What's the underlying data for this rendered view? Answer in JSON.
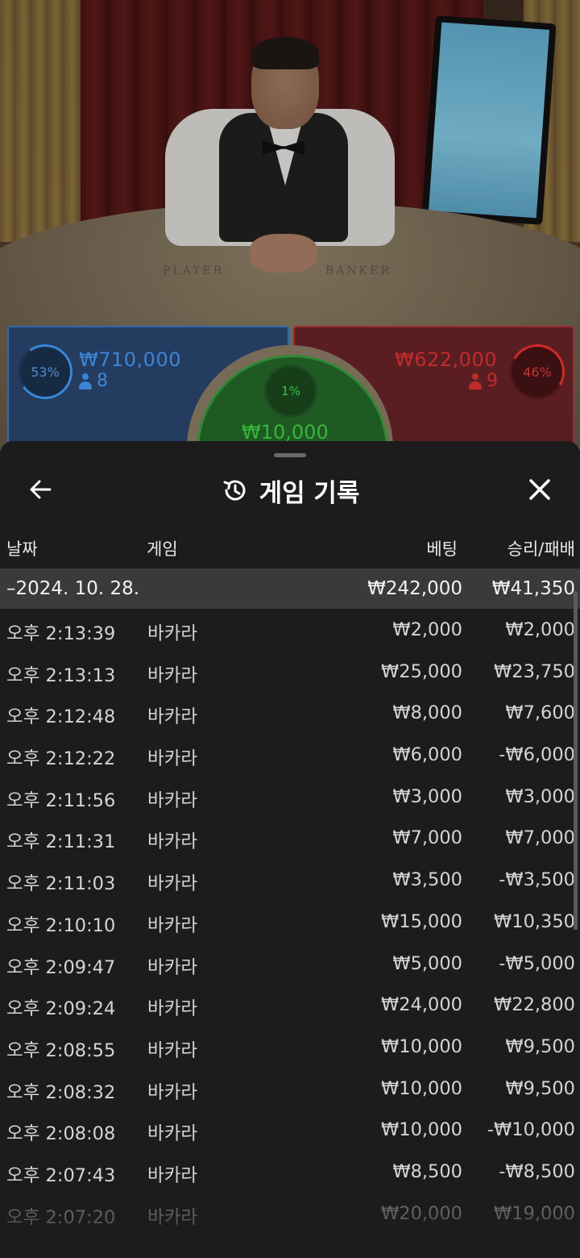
{
  "video": {
    "felt_player_label": "PLAYER",
    "felt_banker_label": "BANKER"
  },
  "bets": {
    "player": {
      "percent": "53%",
      "amount": "₩710,000",
      "players": "8",
      "color": "#3d85d6"
    },
    "banker": {
      "percent": "46%",
      "amount": "₩622,000",
      "players": "9",
      "color": "#c02c2c"
    },
    "tie": {
      "percent": "1%",
      "amount": "₩10,000",
      "color": "#35b63c"
    }
  },
  "sheet": {
    "title": "게임 기록",
    "back_icon": "arrow-left-icon",
    "title_icon": "history-icon",
    "close_icon": "close-icon",
    "columns": {
      "date": "날짜",
      "game": "게임",
      "bet": "베팅",
      "win_loss": "승리/패배"
    },
    "date_group": {
      "date": "–2024. 10. 28.",
      "bet_total": "₩242,000",
      "win_total": "₩41,350"
    },
    "rows": [
      {
        "time": "오후 2:13:39",
        "game": "바카라",
        "bet": "₩2,000",
        "win": "₩2,000"
      },
      {
        "time": "오후 2:13:13",
        "game": "바카라",
        "bet": "₩25,000",
        "win": "₩23,750"
      },
      {
        "time": "오후 2:12:48",
        "game": "바카라",
        "bet": "₩8,000",
        "win": "₩7,600"
      },
      {
        "time": "오후 2:12:22",
        "game": "바카라",
        "bet": "₩6,000",
        "win": "-₩6,000"
      },
      {
        "time": "오후 2:11:56",
        "game": "바카라",
        "bet": "₩3,000",
        "win": "₩3,000"
      },
      {
        "time": "오후 2:11:31",
        "game": "바카라",
        "bet": "₩7,000",
        "win": "₩7,000"
      },
      {
        "time": "오후 2:11:03",
        "game": "바카라",
        "bet": "₩3,500",
        "win": "-₩3,500"
      },
      {
        "time": "오후 2:10:10",
        "game": "바카라",
        "bet": "₩15,000",
        "win": "₩10,350"
      },
      {
        "time": "오후 2:09:47",
        "game": "바카라",
        "bet": "₩5,000",
        "win": "-₩5,000"
      },
      {
        "time": "오후 2:09:24",
        "game": "바카라",
        "bet": "₩24,000",
        "win": "₩22,800"
      },
      {
        "time": "오후 2:08:55",
        "game": "바카라",
        "bet": "₩10,000",
        "win": "₩9,500"
      },
      {
        "time": "오후 2:08:32",
        "game": "바카라",
        "bet": "₩10,000",
        "win": "₩9,500"
      },
      {
        "time": "오후 2:08:08",
        "game": "바카라",
        "bet": "₩10,000",
        "win": "-₩10,000"
      },
      {
        "time": "오후 2:07:43",
        "game": "바카라",
        "bet": "₩8,500",
        "win": "-₩8,500"
      },
      {
        "time": "오후 2:07:20",
        "game": "바카라",
        "bet": "₩20,000",
        "win": "₩19,000"
      }
    ]
  }
}
